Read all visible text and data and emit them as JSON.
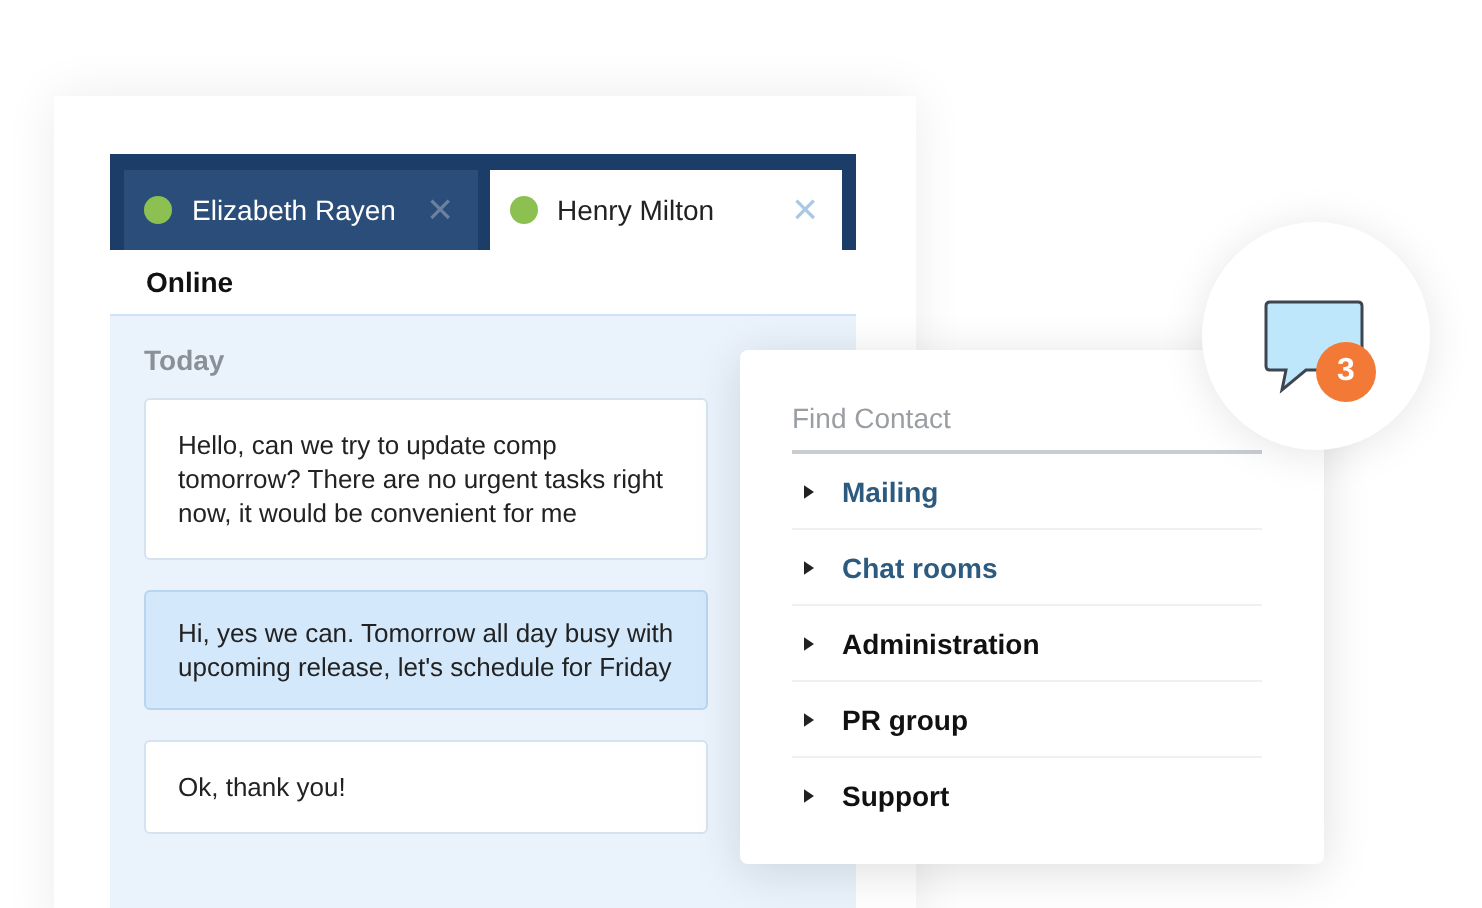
{
  "tabs": [
    {
      "name": "Elizabeth Rayen",
      "selected": false,
      "online": true,
      "close": "×"
    },
    {
      "name": "Henry Milton",
      "selected": true,
      "online": true,
      "close": "×"
    }
  ],
  "status": "Online",
  "day": "Today",
  "messages": [
    {
      "text": "Hello, can we try to update comp tomorrow? There are no urgent tasks right now, it would be convenient for me",
      "outgoing": false
    },
    {
      "text": "Hi, yes we can. Tomorrow all day busy with upcoming release, let's schedule for Friday",
      "outgoing": true
    },
    {
      "text": "Ok, thank you!",
      "outgoing": false
    }
  ],
  "contacts": {
    "search": {
      "placeholder": "Find Contact"
    },
    "groups": [
      {
        "label": "Mailing",
        "highlighted": true
      },
      {
        "label": "Chat rooms",
        "highlighted": true
      },
      {
        "label": "Administration",
        "highlighted": false
      },
      {
        "label": "PR group",
        "highlighted": false
      },
      {
        "label": "Support",
        "highlighted": false
      }
    ]
  },
  "notification": {
    "count": "3"
  }
}
